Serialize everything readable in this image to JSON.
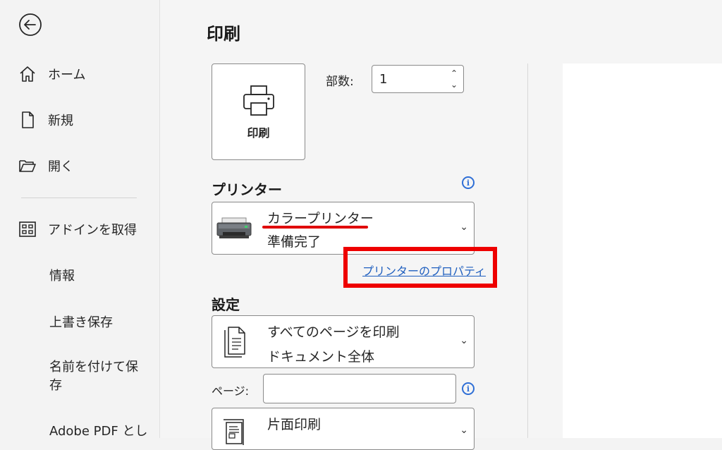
{
  "sidebar": {
    "back_label": "",
    "items": [
      {
        "label": "ホーム",
        "icon": "home-icon"
      },
      {
        "label": "新規",
        "icon": "new-document-icon"
      },
      {
        "label": "開く",
        "icon": "open-folder-icon"
      },
      {
        "label": "アドインを取得",
        "icon": "add-ins-grid-icon"
      },
      {
        "label": "情報"
      },
      {
        "label": "上書き保存"
      },
      {
        "label": "名前を付けて保\n存"
      },
      {
        "label": "Adobe PDF とし"
      }
    ]
  },
  "main": {
    "title": "印刷",
    "print_button": {
      "label": "印刷",
      "icon": "printer-icon"
    },
    "copies": {
      "label": "部数:",
      "value": "1"
    },
    "printer": {
      "heading": "プリンター",
      "name": "カラープリンター",
      "status": "準備完了",
      "properties_link": "プリンターのプロパティ",
      "icon": "printer-device-icon"
    },
    "settings": {
      "heading": "設定",
      "print_range": {
        "title": "すべてのページを印刷",
        "subtitle": "ドキュメント全体",
        "icon": "pages-icon"
      },
      "pages_label": "ページ:",
      "pages_value": "",
      "sides": {
        "title": "片面印刷",
        "icon": "one-sided-icon"
      }
    }
  },
  "colors": {
    "highlight_red": "#ee0000",
    "link_blue": "#1f5fbf",
    "info_blue": "#2f6fd6"
  }
}
